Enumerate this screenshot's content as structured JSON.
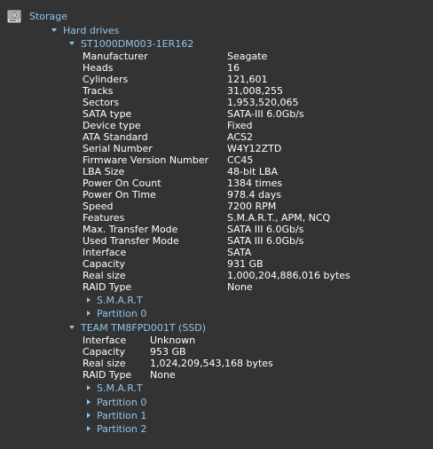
{
  "tree": {
    "root_label": "Storage",
    "hard_drives_label": "Hard drives",
    "drive1": {
      "label": "ST1000DM003-1ER162",
      "properties": [
        {
          "key": "Manufacturer",
          "value": "Seagate"
        },
        {
          "key": "Heads",
          "value": "16"
        },
        {
          "key": "Cylinders",
          "value": "121,601"
        },
        {
          "key": "Tracks",
          "value": "31,008,255"
        },
        {
          "key": "Sectors",
          "value": "1,953,520,065"
        },
        {
          "key": "SATA type",
          "value": "SATA-III 6.0Gb/s"
        },
        {
          "key": "Device type",
          "value": "Fixed"
        },
        {
          "key": "ATA Standard",
          "value": "ACS2"
        },
        {
          "key": "Serial Number",
          "value": "W4Y12ZTD"
        },
        {
          "key": "Firmware Version Number",
          "value": "CC45"
        },
        {
          "key": "LBA Size",
          "value": "48-bit LBA"
        },
        {
          "key": "Power On Count",
          "value": "1384 times"
        },
        {
          "key": "Power On Time",
          "value": "978.4 days"
        },
        {
          "key": "Speed",
          "value": "7200 RPM"
        },
        {
          "key": "Features",
          "value": "S.M.A.R.T., APM, NCQ"
        },
        {
          "key": "Max. Transfer Mode",
          "value": "SATA III 6.0Gb/s"
        },
        {
          "key": "Used Transfer Mode",
          "value": "SATA III 6.0Gb/s"
        },
        {
          "key": "Interface",
          "value": "SATA"
        },
        {
          "key": "Capacity",
          "value": "931 GB"
        },
        {
          "key": "Real size",
          "value": "1,000,204,886,016 bytes"
        },
        {
          "key": "RAID Type",
          "value": "None"
        }
      ],
      "children": [
        "S.M.A.R.T",
        "Partition 0"
      ]
    },
    "drive2": {
      "label": "TEAM TM8FPD001T (SSD)",
      "properties": [
        {
          "key": "Interface",
          "value": "Unknown"
        },
        {
          "key": "Capacity",
          "value": "953 GB"
        },
        {
          "key": "Real size",
          "value": "1,024,209,543,168 bytes"
        },
        {
          "key": "RAID Type",
          "value": "None"
        }
      ],
      "children": [
        "S.M.A.R.T",
        "Partition 0",
        "Partition 1",
        "Partition 2"
      ]
    }
  },
  "colors": {
    "background": "#333333",
    "node_text": "#8fc5ee",
    "property_text": "#ffffff"
  },
  "icons": {
    "storage": "hard-disk-icon",
    "expanded": "triangle-down-icon",
    "collapsed": "triangle-right-icon"
  }
}
